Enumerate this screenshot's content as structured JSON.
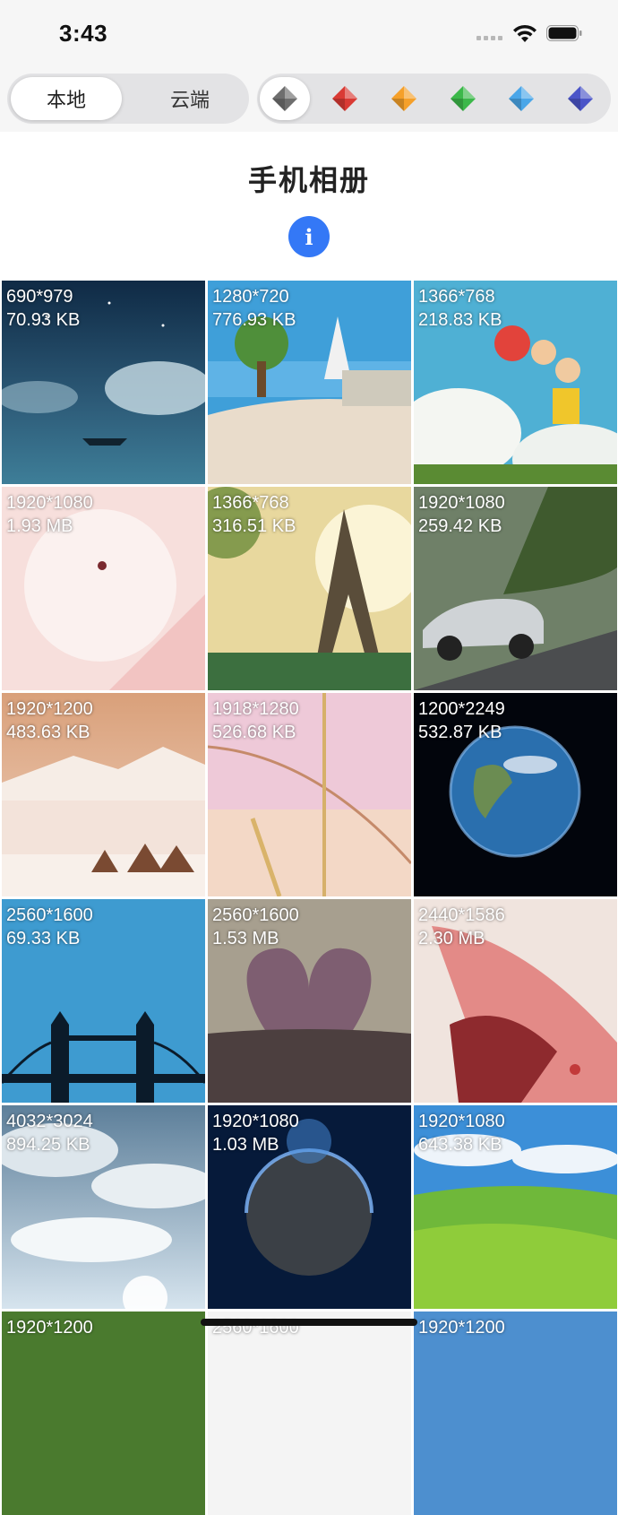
{
  "status": {
    "time": "3:43"
  },
  "tabs": {
    "local": "本地",
    "cloud": "云端"
  },
  "gem_colors": [
    "#6e6e6e",
    "#d93a34",
    "#f5a02a",
    "#3cb84a",
    "#4aa6e8",
    "#4b55c8"
  ],
  "header": {
    "title": "手机相册",
    "info_icon": "i"
  },
  "photos": [
    {
      "size": "690*979",
      "filesize": "70.93 KB",
      "scene": "night-sky-boat"
    },
    {
      "size": "1280*720",
      "filesize": "776.93 KB",
      "scene": "seaside-town"
    },
    {
      "size": "1366*768",
      "filesize": "218.83 KB",
      "scene": "ponyo-sky"
    },
    {
      "size": "1920*1080",
      "filesize": "1.93 MB",
      "scene": "pink-balloon"
    },
    {
      "size": "1366*768",
      "filesize": "316.51 KB",
      "scene": "eiffel-tower"
    },
    {
      "size": "1920*1080",
      "filesize": "259.42 KB",
      "scene": "sports-car"
    },
    {
      "size": "1920*1200",
      "filesize": "483.63 KB",
      "scene": "snowy-mountains"
    },
    {
      "size": "1918*1280",
      "filesize": "526.68 KB",
      "scene": "pink-grass"
    },
    {
      "size": "1200*2249",
      "filesize": "532.87 KB",
      "scene": "earth-space"
    },
    {
      "size": "2560*1600",
      "filesize": "69.33 KB",
      "scene": "tower-bridge"
    },
    {
      "size": "2560*1600",
      "filesize": "1.53 MB",
      "scene": "book-heart"
    },
    {
      "size": "2440*1586",
      "filesize": "2.30 MB",
      "scene": "anime-girl"
    },
    {
      "size": "4032*3024",
      "filesize": "894.25 KB",
      "scene": "cloudy-sky"
    },
    {
      "size": "1920*1080",
      "filesize": "1.03 MB",
      "scene": "dark-planet"
    },
    {
      "size": "1920*1080",
      "filesize": "643.38 KB",
      "scene": "green-hills"
    },
    {
      "size": "1920*1200",
      "filesize": "",
      "scene": "forest"
    },
    {
      "size": "2560*1600",
      "filesize": "",
      "scene": "white"
    },
    {
      "size": "1920*1200",
      "filesize": "",
      "scene": "blue-sky"
    }
  ]
}
